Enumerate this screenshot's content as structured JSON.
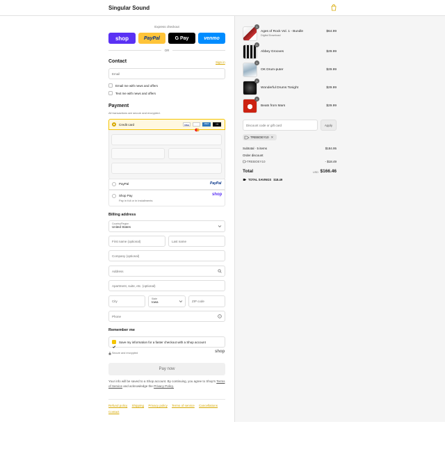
{
  "header": {
    "store_name": "Singular Sound",
    "cart_icon": "shopping-bag-icon",
    "accent": "#f5c400"
  },
  "express": {
    "label": "Express checkout",
    "buttons": [
      {
        "label": "shop",
        "color": "#5a31f4"
      },
      {
        "label": "PayPal",
        "color": "#ffc439"
      },
      {
        "label": "G Pay",
        "color": "#000000"
      },
      {
        "label": "venmo",
        "color": "#008cff"
      }
    ],
    "or": "OR"
  },
  "contact": {
    "title": "Contact",
    "sign_in": "Sign in",
    "email_placeholder": "Email",
    "opt1": "Email me with news and offers",
    "opt2": "Text me with news and offers"
  },
  "payment": {
    "title": "Payment",
    "subtitle": "All transactions are secure and encrypted.",
    "credit_card": "Credit card",
    "card_badges": [
      "VISA",
      "MC",
      "AMEX",
      "+3"
    ],
    "paypal": "PayPal",
    "paypal_logo": "PayPal",
    "shop_pay": "Shop Pay",
    "shop_pay_sub": "Pay in full or in installments",
    "shop_logo": "shop"
  },
  "billing": {
    "title": "Billing address",
    "country_label": "Country/Region",
    "country_value": "United States",
    "first_name": "First name (optional)",
    "last_name": "Last name",
    "company": "Company (optional)",
    "address": "Address",
    "apartment": "Apartment, suite, etc. (optional)",
    "city": "City",
    "state_label": "State",
    "state_value": "Iowa",
    "zip": "ZIP code",
    "phone": "Phone"
  },
  "remember": {
    "title": "Remember me",
    "save_label": "Save my information for a faster checkout with a Shop account",
    "secure": "Secure and encrypted",
    "shop_logo": "shop"
  },
  "pay_now": "Pay now",
  "disclaimer": {
    "text1": "Your info will be saved to a Shop account. By continuing, you agree to Shop's",
    "terms": "Terms of Service",
    "text2": "and acknowledge the",
    "privacy": "Privacy Policy."
  },
  "footer_links": [
    "Refund policy",
    "Shipping",
    "Privacy policy",
    "Terms of service",
    "Cancellations",
    "Contact"
  ],
  "cart": {
    "items": [
      {
        "name": "Ages of Rock Vol. 1 - Bundle",
        "sub": "Digital Download",
        "price": "$64.99",
        "qty": "1"
      },
      {
        "name": "Abbey Grooves",
        "sub": "",
        "price": "$29.99",
        "qty": "1"
      },
      {
        "name": "OK Drum-puter",
        "sub": "",
        "price": "$29.99",
        "qty": "1"
      },
      {
        "name": "Wonderful Drums Tonight",
        "sub": "",
        "price": "$29.99",
        "qty": "1"
      },
      {
        "name": "Beats from Mars",
        "sub": "",
        "price": "$29.99",
        "qty": "1"
      }
    ],
    "discount_placeholder": "Discount code or gift card",
    "apply": "Apply",
    "code": "TREBOEY10",
    "subtotal_label": "Subtotal · 5 items",
    "subtotal": "$184.95",
    "order_discount": "Order discount",
    "discount_code": "TREBOEY10",
    "discount_value": "- $18.49",
    "total_label": "Total",
    "currency": "USD",
    "total": "$166.46",
    "savings_label": "TOTAL SAVINGS",
    "savings": "$18.49"
  }
}
